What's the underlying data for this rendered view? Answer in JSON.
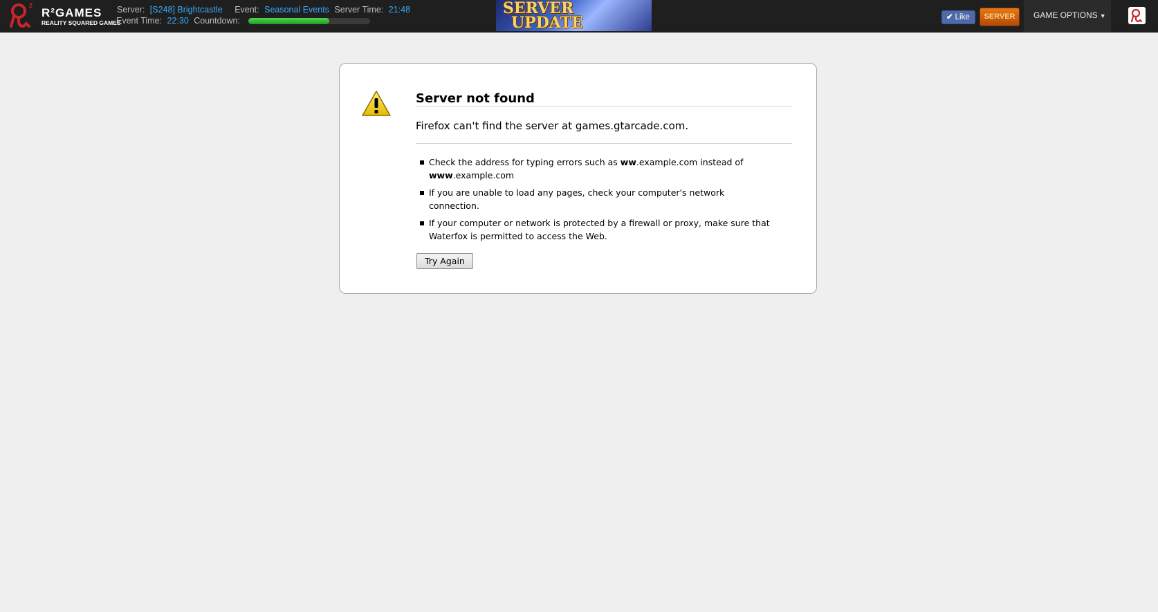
{
  "topbar": {
    "logo": {
      "title": "R²GAMES",
      "subtitle": "REALITY SQUARED GAMES"
    },
    "server_label": "Server:",
    "server_value": "[S248] Brightcastle",
    "event_label": "Event:",
    "event_value": "Seasonal Events",
    "server_time_label": "Server Time:",
    "server_time_value": "21:48",
    "event_time_label": "Event Time:",
    "event_time_value": "22:30",
    "countdown_label": "Countdown:",
    "countdown_progress": 0.66,
    "banner_line1": "SERVER",
    "banner_line2": "UPDATE",
    "like_label": "Like",
    "server_button": "SERVER",
    "game_options": "GAME OPTIONS",
    "colors": {
      "bar_bg": "#1f1f1f",
      "value_blue": "#3aa9f5",
      "server_orange": "#d0620f"
    }
  },
  "error": {
    "title": "Server not found",
    "message": "Firefox can't find the server at games.gtarcade.com.",
    "tips": [
      {
        "pre": "Check the address for typing errors such as ",
        "b1": "ww",
        "mid": ".example.com instead of ",
        "b2": "www",
        "post": ".example.com"
      },
      {
        "text": "If you are unable to load any pages, check your computer's network connection."
      },
      {
        "text": "If your computer or network is protected by a firewall or proxy, make sure that Waterfox is permitted to access the Web."
      }
    ],
    "try_again": "Try Again",
    "icon": "warning-triangle-icon"
  }
}
